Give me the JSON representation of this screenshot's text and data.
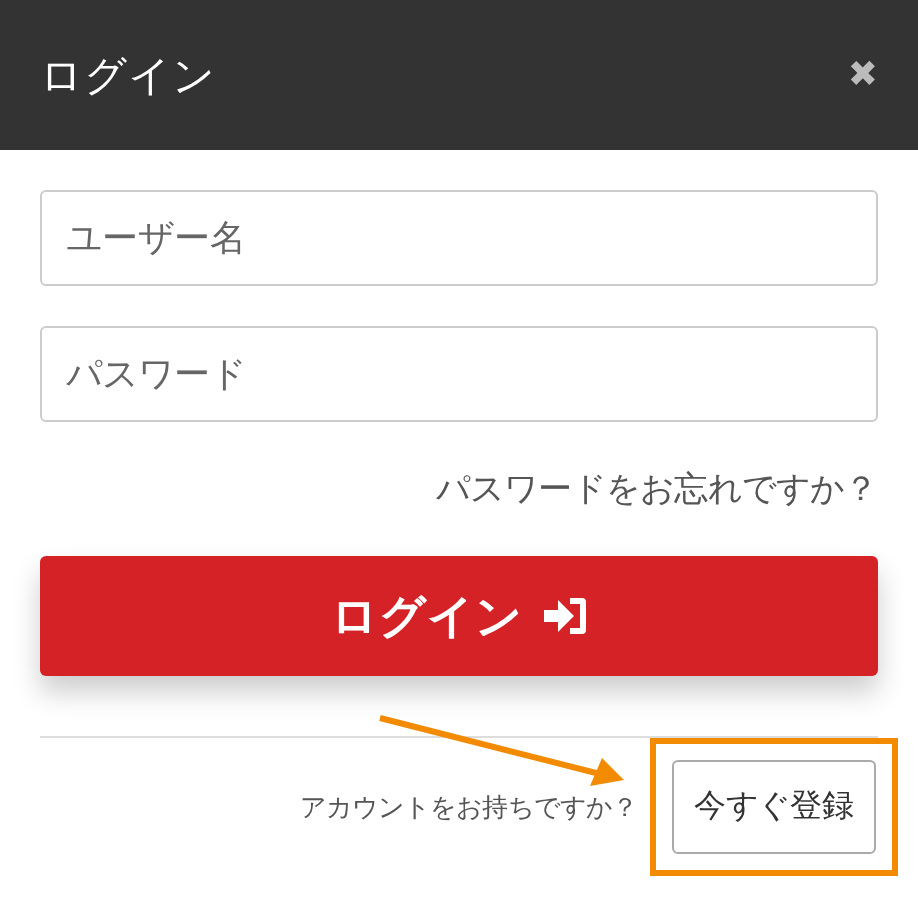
{
  "dialog": {
    "title": "ログイン",
    "close": "✖"
  },
  "fields": [
    {
      "placeholder": "ユーザー名"
    },
    {
      "placeholder": "パスワード"
    }
  ],
  "forgot_link": "パスワードをお忘れですか？",
  "login_button": "ログイン",
  "footer": {
    "question": "アカウントをお持ちですか？",
    "register_button": "今すぐ登録"
  }
}
